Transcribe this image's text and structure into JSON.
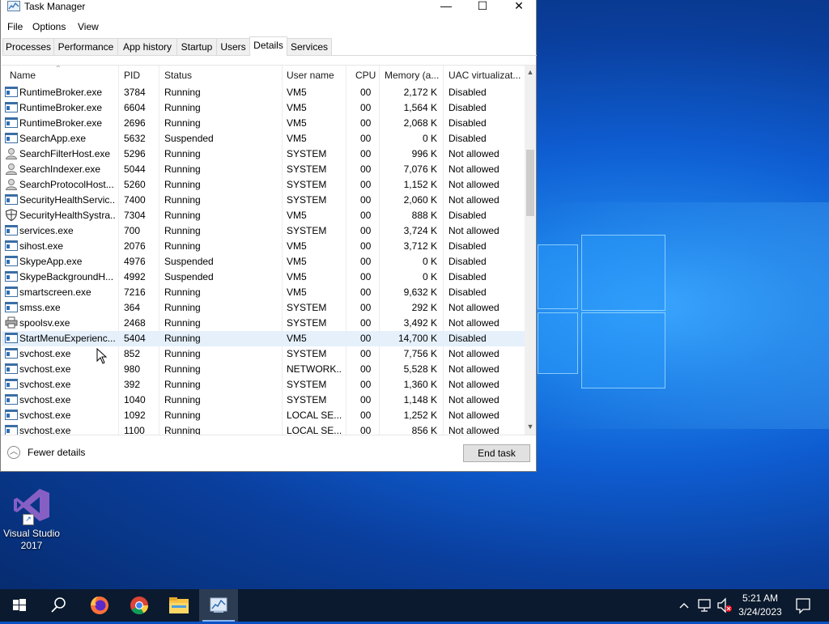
{
  "window": {
    "title": "Task Manager",
    "minimize_label": "—",
    "maximize_label": "☐",
    "close_label": "✕"
  },
  "menu": [
    "File",
    "Options",
    "View"
  ],
  "tabs": [
    "Processes",
    "Performance",
    "App history",
    "Startup",
    "Users",
    "Details",
    "Services"
  ],
  "active_tab": "Details",
  "columns": [
    "Name",
    "PID",
    "Status",
    "User name",
    "CPU",
    "Memory (a...",
    "UAC virtualizat..."
  ],
  "sort_indicator": "^",
  "rows": [
    {
      "icon": "app-window",
      "name": "RuntimeBroker.exe",
      "pid": "3784",
      "status": "Running",
      "user": "VM5",
      "cpu": "00",
      "mem": "2,172 K",
      "uac": "Disabled"
    },
    {
      "icon": "app-window",
      "name": "RuntimeBroker.exe",
      "pid": "6604",
      "status": "Running",
      "user": "VM5",
      "cpu": "00",
      "mem": "1,564 K",
      "uac": "Disabled"
    },
    {
      "icon": "app-window",
      "name": "RuntimeBroker.exe",
      "pid": "2696",
      "status": "Running",
      "user": "VM5",
      "cpu": "00",
      "mem": "2,068 K",
      "uac": "Disabled"
    },
    {
      "icon": "app-window",
      "name": "SearchApp.exe",
      "pid": "5632",
      "status": "Suspended",
      "user": "VM5",
      "cpu": "00",
      "mem": "0 K",
      "uac": "Disabled"
    },
    {
      "icon": "user-search",
      "name": "SearchFilterHost.exe",
      "pid": "5296",
      "status": "Running",
      "user": "SYSTEM",
      "cpu": "00",
      "mem": "996 K",
      "uac": "Not allowed"
    },
    {
      "icon": "user-search",
      "name": "SearchIndexer.exe",
      "pid": "5044",
      "status": "Running",
      "user": "SYSTEM",
      "cpu": "00",
      "mem": "7,076 K",
      "uac": "Not allowed"
    },
    {
      "icon": "user-search",
      "name": "SearchProtocolHost....",
      "pid": "5260",
      "status": "Running",
      "user": "SYSTEM",
      "cpu": "00",
      "mem": "1,152 K",
      "uac": "Not allowed"
    },
    {
      "icon": "app-window",
      "name": "SecurityHealthServic...",
      "pid": "7400",
      "status": "Running",
      "user": "SYSTEM",
      "cpu": "00",
      "mem": "2,060 K",
      "uac": "Not allowed"
    },
    {
      "icon": "shield",
      "name": "SecurityHealthSystra...",
      "pid": "7304",
      "status": "Running",
      "user": "VM5",
      "cpu": "00",
      "mem": "888 K",
      "uac": "Disabled"
    },
    {
      "icon": "app-window",
      "name": "services.exe",
      "pid": "700",
      "status": "Running",
      "user": "SYSTEM",
      "cpu": "00",
      "mem": "3,724 K",
      "uac": "Not allowed"
    },
    {
      "icon": "app-window",
      "name": "sihost.exe",
      "pid": "2076",
      "status": "Running",
      "user": "VM5",
      "cpu": "00",
      "mem": "3,712 K",
      "uac": "Disabled"
    },
    {
      "icon": "app-window",
      "name": "SkypeApp.exe",
      "pid": "4976",
      "status": "Suspended",
      "user": "VM5",
      "cpu": "00",
      "mem": "0 K",
      "uac": "Disabled"
    },
    {
      "icon": "app-window",
      "name": "SkypeBackgroundH...",
      "pid": "4992",
      "status": "Suspended",
      "user": "VM5",
      "cpu": "00",
      "mem": "0 K",
      "uac": "Disabled"
    },
    {
      "icon": "app-window",
      "name": "smartscreen.exe",
      "pid": "7216",
      "status": "Running",
      "user": "VM5",
      "cpu": "00",
      "mem": "9,632 K",
      "uac": "Disabled"
    },
    {
      "icon": "app-window",
      "name": "smss.exe",
      "pid": "364",
      "status": "Running",
      "user": "SYSTEM",
      "cpu": "00",
      "mem": "292 K",
      "uac": "Not allowed"
    },
    {
      "icon": "printer",
      "name": "spoolsv.exe",
      "pid": "2468",
      "status": "Running",
      "user": "SYSTEM",
      "cpu": "00",
      "mem": "3,492 K",
      "uac": "Not allowed"
    },
    {
      "icon": "app-window",
      "name": "StartMenuExperienc...",
      "pid": "5404",
      "status": "Running",
      "user": "VM5",
      "cpu": "00",
      "mem": "14,700 K",
      "uac": "Disabled"
    },
    {
      "icon": "app-window",
      "name": "svchost.exe",
      "pid": "852",
      "status": "Running",
      "user": "SYSTEM",
      "cpu": "00",
      "mem": "7,756 K",
      "uac": "Not allowed"
    },
    {
      "icon": "app-window",
      "name": "svchost.exe",
      "pid": "980",
      "status": "Running",
      "user": "NETWORK...",
      "cpu": "00",
      "mem": "5,528 K",
      "uac": "Not allowed"
    },
    {
      "icon": "app-window",
      "name": "svchost.exe",
      "pid": "392",
      "status": "Running",
      "user": "SYSTEM",
      "cpu": "00",
      "mem": "1,360 K",
      "uac": "Not allowed"
    },
    {
      "icon": "app-window",
      "name": "svchost.exe",
      "pid": "1040",
      "status": "Running",
      "user": "SYSTEM",
      "cpu": "00",
      "mem": "1,148 K",
      "uac": "Not allowed"
    },
    {
      "icon": "app-window",
      "name": "svchost.exe",
      "pid": "1092",
      "status": "Running",
      "user": "LOCAL SE...",
      "cpu": "00",
      "mem": "1,252 K",
      "uac": "Not allowed"
    },
    {
      "icon": "app-window",
      "name": "svchost.exe",
      "pid": "1100",
      "status": "Running",
      "user": "LOCAL SE...",
      "cpu": "00",
      "mem": "856 K",
      "uac": "Not allowed"
    }
  ],
  "selected_row": 16,
  "footer": {
    "fewer_details": "Fewer details",
    "end_task": "End task"
  },
  "desktop_icon": {
    "line1": "Visual Studio",
    "line2": "2017"
  },
  "taskbar": {
    "pinned": [
      "start-icon",
      "search-icon",
      "firefox-icon",
      "chrome-icon",
      "file-explorer-icon",
      "task-manager-icon"
    ],
    "active": "task-manager-icon",
    "time": "5:21 AM",
    "date": "3/24/2023"
  },
  "colors": {
    "selection": "#e5f0fb",
    "taskbar": "#0b1a2e",
    "desktop": "#0e5cd0",
    "vs_purple": "#865fc5"
  }
}
